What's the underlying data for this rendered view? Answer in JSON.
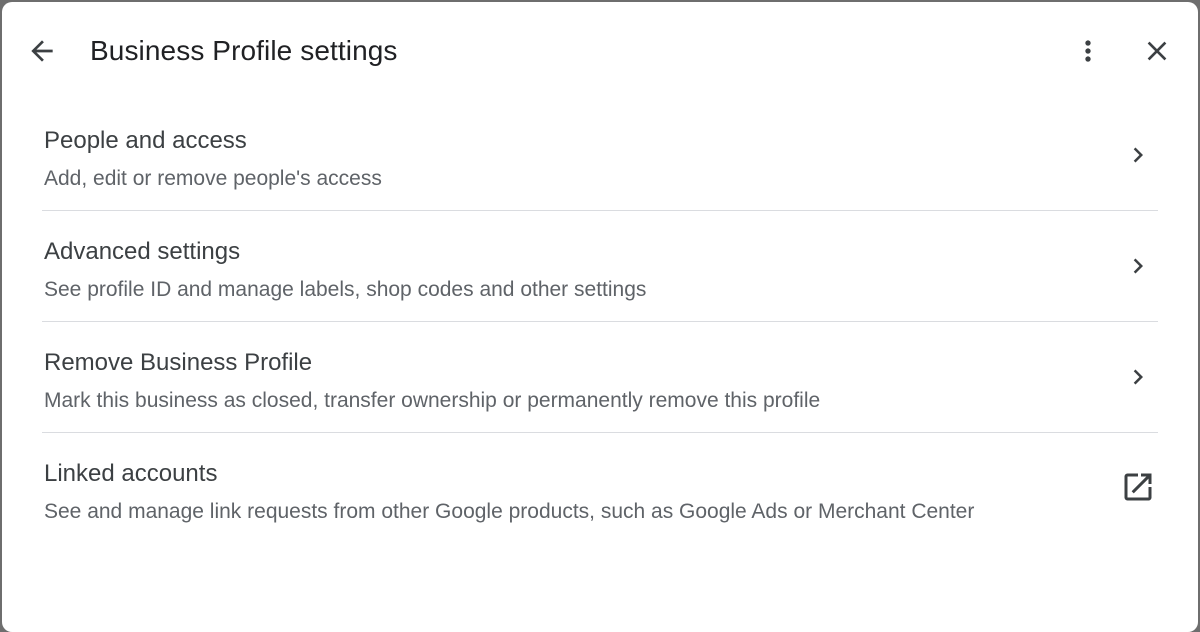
{
  "header": {
    "title": "Business Profile settings",
    "back_icon": "arrow-back-icon",
    "more_icon": "more-vert-icon",
    "close_icon": "close-icon"
  },
  "items": [
    {
      "title": "People and access",
      "subtitle": "Add, edit or remove people's access",
      "icon": "chevron-right-icon"
    },
    {
      "title": "Advanced settings",
      "subtitle": "See profile ID and manage labels, shop codes and other settings",
      "icon": "chevron-right-icon"
    },
    {
      "title": "Remove Business Profile",
      "subtitle": "Mark this business as closed, transfer ownership or permanently remove this profile",
      "icon": "chevron-right-icon"
    },
    {
      "title": "Linked accounts",
      "subtitle": "See and manage link requests from other Google products, such as Google Ads or Merchant Center",
      "icon": "open-in-new-icon"
    }
  ],
  "colors": {
    "title": "#202124",
    "item_title": "#3c4043",
    "subtitle": "#5f6368",
    "divider": "#dadce0",
    "icon": "#3c4043"
  }
}
